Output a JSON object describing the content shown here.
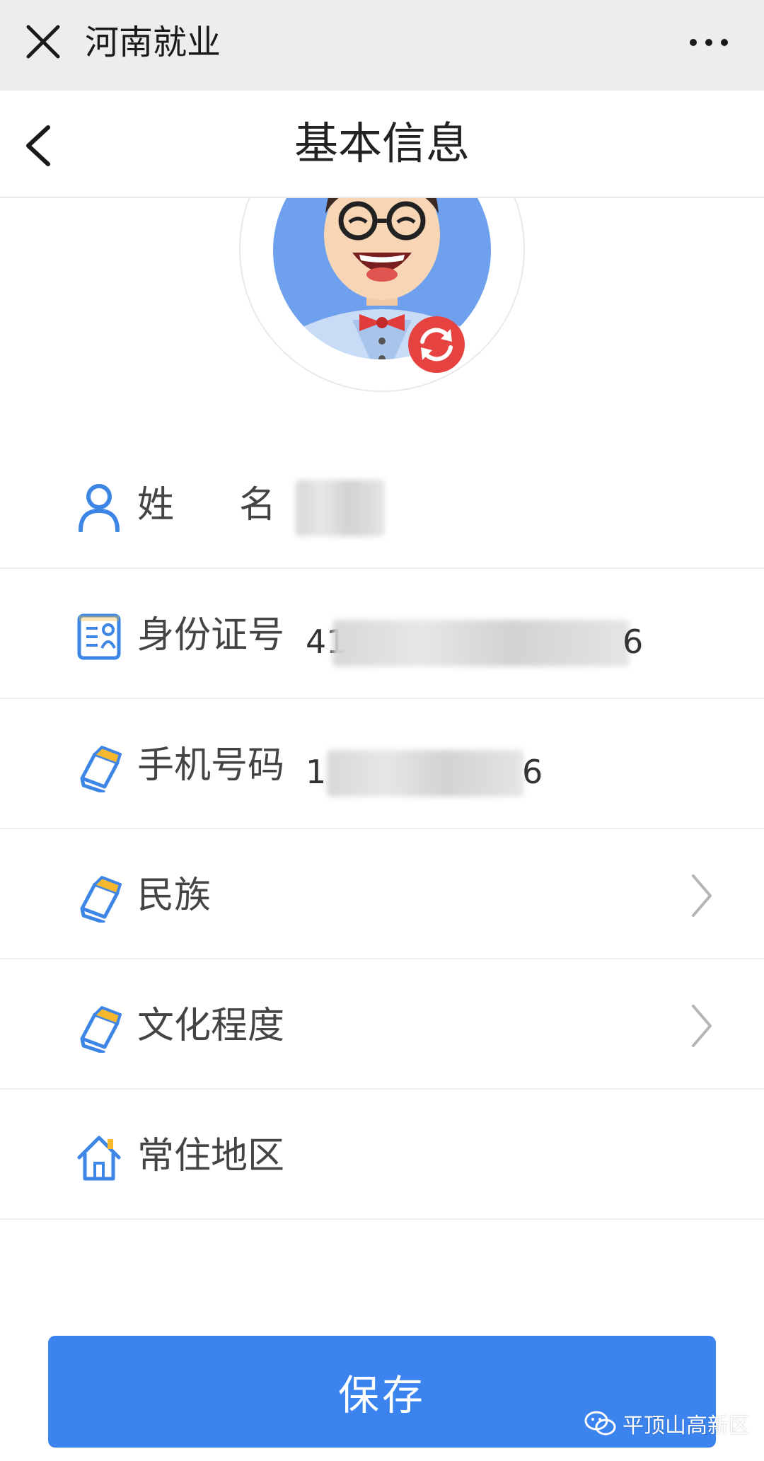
{
  "wechat_bar": {
    "title": "河南就业",
    "close_icon": "close-icon",
    "more_icon": "more-dots-icon"
  },
  "header": {
    "title": "基本信息",
    "back_icon": "chevron-left-icon"
  },
  "avatar": {
    "refresh_icon": "refresh-icon",
    "badge_color": "#e64340"
  },
  "form": {
    "rows": [
      {
        "label": "姓名",
        "icon": "user-icon",
        "value": "",
        "has_chevron": false
      },
      {
        "label": "身份证号",
        "icon": "id-card-icon",
        "value_prefix": "41",
        "value_suffix": "6",
        "has_chevron": false
      },
      {
        "label": "手机号码",
        "icon": "book-icon",
        "value_prefix": "1",
        "value_suffix": "6",
        "has_chevron": false
      },
      {
        "label": "民族",
        "icon": "book-icon",
        "value": "",
        "has_chevron": true
      },
      {
        "label": "文化程度",
        "icon": "book-icon",
        "value": "",
        "has_chevron": true
      },
      {
        "label": "常住地区",
        "icon": "home-icon",
        "value": "",
        "has_chevron": false
      }
    ]
  },
  "save_button": {
    "label": "保存",
    "color": "#3b84f0"
  },
  "watermark": {
    "text": "平顶山高新区",
    "icon": "wechat-icon"
  },
  "colors": {
    "accent": "#3b84f0",
    "icon_blue": "#3d86e6",
    "icon_yellow": "#f5b82e"
  }
}
